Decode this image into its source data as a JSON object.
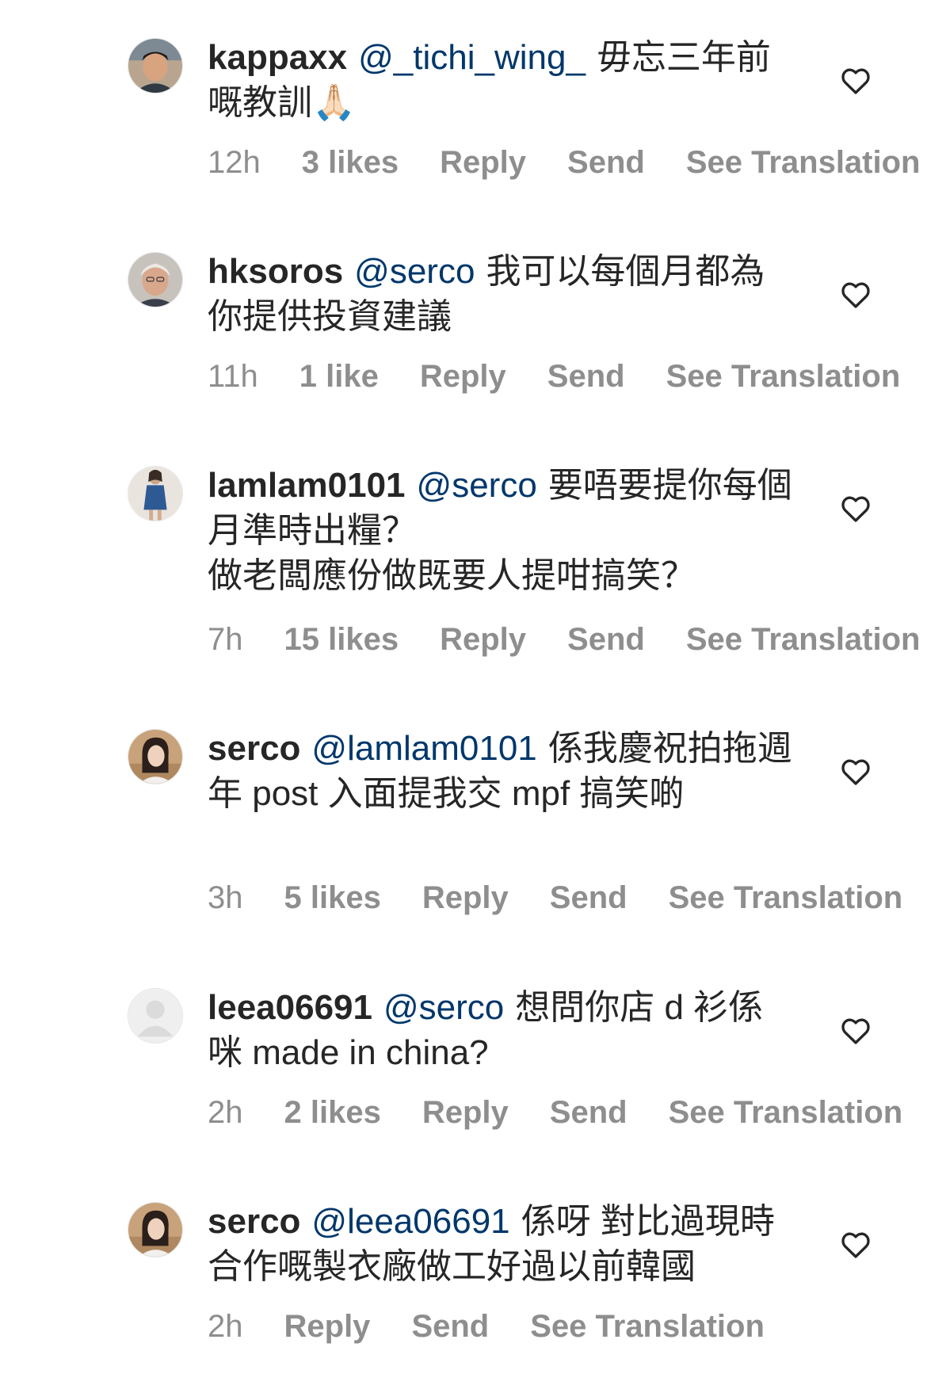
{
  "comments": [
    {
      "username": "kappaxx",
      "mention": "@_tichi_wing_",
      "text": "毋忘三年前嘅教訓🙏🏻",
      "time": "12h",
      "likes": "3 likes",
      "reply": "Reply",
      "send": "Send",
      "translation": "See Translation"
    },
    {
      "username": "hksoros",
      "mention": "@serco",
      "text": "我可以每個月都為你提供投資建議",
      "time": "11h",
      "likes": "1 like",
      "reply": "Reply",
      "send": "Send",
      "translation": "See Translation"
    },
    {
      "username": "lamlam0101",
      "mention": "@serco",
      "text": "要唔要提你每個月準時出糧？",
      "text2": "做老闆應份做既要人提咁搞笑？",
      "time": "7h",
      "likes": "15 likes",
      "reply": "Reply",
      "send": "Send",
      "translation": "See Translation"
    },
    {
      "username": "serco",
      "mention": "@lamlam0101",
      "text": "係我慶祝拍拖週年 post 入面提我交 mpf 搞笑啲",
      "time": "3h",
      "likes": "5 likes",
      "reply": "Reply",
      "send": "Send",
      "translation": "See Translation"
    },
    {
      "username": "leea06691",
      "mention": "@serco",
      "text": "想問你店 d 衫係咪 made in china?",
      "time": "2h",
      "likes": "2 likes",
      "reply": "Reply",
      "send": "Send",
      "translation": "See Translation"
    },
    {
      "username": "serco",
      "mention": "@leea06691",
      "text": "係呀 對比過現時合作嘅製衣廠做工好過以前韓國",
      "time": "2h",
      "reply": "Reply",
      "send": "Send",
      "translation": "See Translation"
    }
  ],
  "icons": {
    "like": "heart-outline-icon",
    "avatar_placeholder": "default-avatar-icon"
  },
  "colors": {
    "text": "#262626",
    "mention": "#00376b",
    "secondary": "#8e8e8e"
  }
}
